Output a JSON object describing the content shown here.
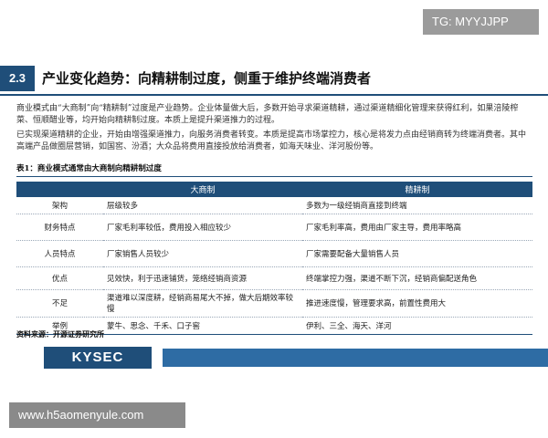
{
  "badge": "TG: MYYJJPP",
  "section": {
    "number": "2.3",
    "title": "产业变化趋势：向精耕制过度，侧重于维护终端消费者"
  },
  "paragraphs": [
    "商业模式由“大商制”向“精耕制”过度是产业趋势。企业体量做大后，多数开始寻求渠道精耕，通过渠道精细化管理来获得红利，如果涪陵榨菜、恒顺醋业等，均开始向精耕制过度。本质上是提升渠道推力的过程。",
    "已实现渠道精耕的企业，开始由增强渠道推力，向服务消费者转变。本质是提高市场掌控力，核心是将发力点由经销商转为终端消费者。其中高端产品做圈层营销，如国窖、汾酒；大众品将费用直接投放给消费者，如海天味业、洋河股份等。"
  ],
  "table": {
    "title": "表1：商业模式通常由大商制向精耕制过度",
    "headers": [
      "",
      "大商制",
      "精耕制"
    ],
    "rows": [
      {
        "label": "架构",
        "a": "层级较多",
        "b": "多数为一级经销商直接到终端"
      },
      {
        "label": "财务特点",
        "a": "厂家毛利率较低，费用投入相应较少",
        "b": "厂家毛利率高，费用由厂家主导，费用率略高"
      },
      {
        "label": "人员特点",
        "a": "厂家销售人员较少",
        "b": "厂家需要配备大量销售人员"
      },
      {
        "label": "优点",
        "a": "见效快，利于迅速铺货，笼络经销商资源",
        "b": "终端掌控力强，渠道不断下沉，经销商偏配送角色"
      },
      {
        "label": "不足",
        "a": "渠道难以深度耕，经销商易尾大不掉，做大后期效率较慢",
        "b": "推进速度慢，管理要求高，前置性费用大"
      },
      {
        "label": "举例",
        "a": "蒙牛、思念、千禾、口子窖",
        "b": "伊利、三全、海天、洋河"
      }
    ]
  },
  "source": "资料来源：开源证券研究所",
  "footer": {
    "logo": "KYSEC"
  },
  "watermark": "www.h5aomenyule.com",
  "colors": {
    "primary": "#1f4e79",
    "stripe": "#2e6ca4",
    "badge": "#9b9b9b"
  }
}
